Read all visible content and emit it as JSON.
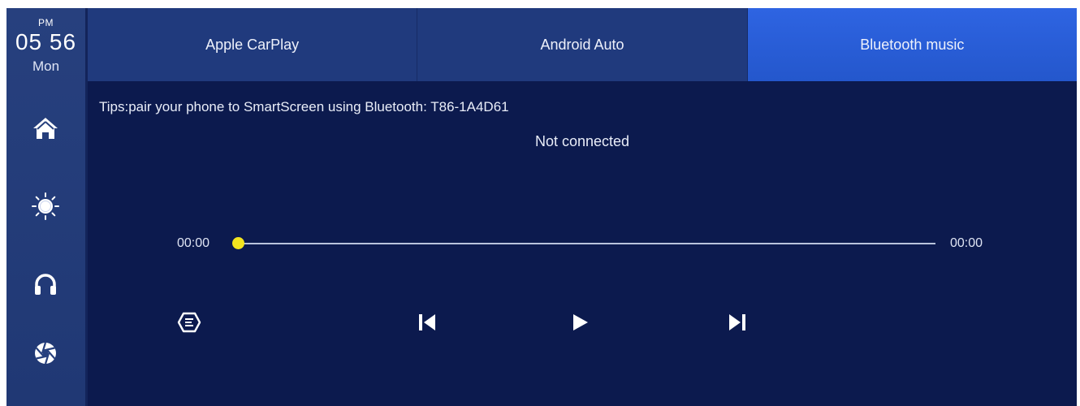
{
  "clock": {
    "ampm": "PM",
    "time": "05 56",
    "day": "Mon"
  },
  "rail": {
    "items": [
      {
        "icon": "home-icon"
      },
      {
        "icon": "brightness-icon"
      },
      {
        "icon": "headphones-icon"
      },
      {
        "icon": "aperture-icon"
      }
    ]
  },
  "tabs": [
    {
      "label": "Apple CarPlay",
      "active": false
    },
    {
      "label": "Android Auto",
      "active": false
    },
    {
      "label": "Bluetooth music",
      "active": true
    }
  ],
  "content": {
    "tips": "Tips:pair your phone to SmartScreen using Bluetooth: T86-1A4D61",
    "status": "Not connected"
  },
  "player": {
    "elapsed": "00:00",
    "duration": "00:00",
    "progress_percent": 0,
    "controls": [
      "playlist-icon",
      "previous-icon",
      "play-icon",
      "next-icon"
    ]
  },
  "colors": {
    "background": "#0c1a4e",
    "rail": "#27407e",
    "tab": "#203a7d",
    "tab_active": "#2e64e2",
    "progress_knob": "#f3e41f"
  }
}
